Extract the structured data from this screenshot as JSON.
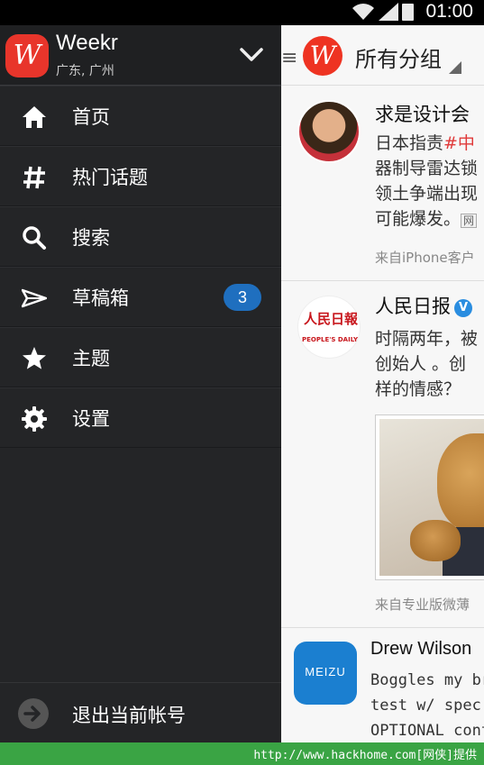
{
  "status_bar": {
    "time": "01:00"
  },
  "drawer": {
    "user": {
      "name": "Weekr",
      "location": "广东, 广州"
    },
    "nav": [
      {
        "label": "首页",
        "icon": "home-icon"
      },
      {
        "label": "热门话题",
        "icon": "hashtag-icon"
      },
      {
        "label": "搜索",
        "icon": "search-icon"
      },
      {
        "label": "草稿箱",
        "icon": "send-icon",
        "badge": "3"
      },
      {
        "label": "主题",
        "icon": "star-icon"
      },
      {
        "label": "设置",
        "icon": "gear-icon"
      }
    ],
    "logout_label": "退出当前帐号"
  },
  "timeline": {
    "group_title": "所有分组",
    "posts": [
      {
        "author": "求是设计会",
        "lines": [
          "日本指责",
          "#中",
          "器制导雷达锁",
          "领土争端出现",
          "可能爆发。",
          "网"
        ],
        "source": "来自iPhone客户"
      },
      {
        "author": "人民日报",
        "avatar_text": "人民日報",
        "avatar_subtext": "PEOPLE'S DAILY",
        "lines": [
          "时隔两年，被",
          "创始人 。创",
          "样的情感？"
        ],
        "source": "来自专业版微薄"
      },
      {
        "author": "Drew Wilson",
        "avatar_text": "MEIZU",
        "lines": [
          "Boggles my bra",
          "test w/ spec w",
          "OPTIONAL cont"
        ]
      }
    ]
  },
  "banner": {
    "text": "http://www.hackhome.com[网侠]提供"
  },
  "colors": {
    "brand": "#e8352b",
    "badge": "#1f6fbf",
    "drawer_bg": "#242527",
    "banner": "#3aa444",
    "hashtag": "#e03a3a",
    "verified": "#2a8de0"
  }
}
